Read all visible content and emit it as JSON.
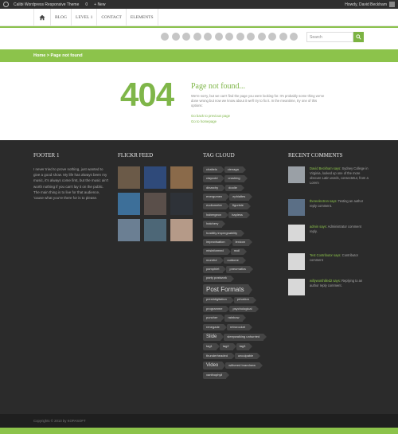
{
  "adminbar": {
    "site_name": "Calibi Wordpress Responsive Theme",
    "comments_count": "0",
    "new_label": "+ New",
    "howdy": "Howdy, David Beckham"
  },
  "nav": {
    "items": [
      "BLOG",
      "LEVEL 1",
      "CONTACT",
      "ELEMENTS"
    ]
  },
  "social_icons": [
    "rss-icon",
    "facebook-icon",
    "twitter-icon",
    "pinterest-icon",
    "google-plus-icon",
    "dribbble-icon",
    "flickr-icon",
    "vimeo-icon",
    "linkedin-icon",
    "skype-icon",
    "youtube-icon",
    "tumblr-icon",
    "foursquare-icon"
  ],
  "search": {
    "placeholder": "Search"
  },
  "breadcrumb": "Home > Page not found",
  "error": {
    "code": "404",
    "title": "Page not found...",
    "message": "We're sorry, but we can't find the page you were looking for. It's probably some thing we've done wrong but now we know about it we'll try to fix it. In the meantime, try one of this options:",
    "link_back": "Go back to previous page",
    "link_home": "Go to homepage"
  },
  "footer": {
    "footer1_title": "FOOTER 1",
    "footer1_text": "I never tried to prove nothing, just wanted to give a good show. My life has always been my music, it's always come first, but the music ain't worth nothing if you can't lay it on the public. The main thing is to live for that audience, 'cause what you're there for is to please.",
    "flickr_title": "FLICKR FEED",
    "tag_title": "TAG CLOUD",
    "comments_title": "RECENT COMMENTS",
    "copyright": "Copyrights © 2013 by KOPASOFT"
  },
  "flickr_photos": [
    {
      "color": "#6b5a48"
    },
    {
      "color": "#2f4a7a"
    },
    {
      "color": "#8a6a4a"
    },
    {
      "color": "#3d6f99"
    },
    {
      "color": "#5a4f4a"
    },
    {
      "color": "#2e3238"
    },
    {
      "color": "#6b7f93"
    },
    {
      "color": "#4d6777"
    },
    {
      "color": "#b59a88"
    }
  ],
  "tags": [
    [
      "chattels",
      "cienaga"
    ],
    [
      "claycold",
      "crushing"
    ],
    [
      "dinarchy",
      "doolie"
    ],
    [
      "energumen",
      "ephialtes"
    ],
    [
      "eudiometer",
      "figuriste"
    ],
    [
      "habergeon",
      "hapless"
    ],
    [
      "hatchery"
    ],
    [
      "hostility impregnability"
    ],
    [
      "improvisation",
      "lexicon"
    ],
    [
      "misinformed",
      "moil"
    ],
    [
      "mornful",
      "outdone"
    ],
    [
      "pamphlet",
      "pneumatics"
    ],
    [
      "party postwork"
    ],
    [
      "Post Formats"
    ],
    [
      "prestidigitation",
      "privation"
    ],
    [
      "programme",
      "psychological"
    ],
    [
      "puncher",
      "rainbow"
    ],
    [
      "renegade",
      "retrorocket"
    ],
    [
      "Slide",
      "sleepwalking unhurried"
    ],
    [
      "tag1",
      "tag2",
      "tag3"
    ],
    [
      "thunderheaded",
      "unculpable"
    ],
    [
      "Video",
      "withered brandnew"
    ],
    [
      "xanthophyll"
    ]
  ],
  "comments": [
    {
      "author": "David Beckham",
      "says": "says:",
      "text": "Sydney College in Virginia, looked up one of the more obscure Latin words, consectetur, from a Lorem",
      "avatar": "#9aa0a6"
    },
    {
      "author": "thereelectron",
      "says": "says:",
      "text": "Testing an author reply comment.",
      "avatar": "#5b6f86"
    },
    {
      "author": "admin",
      "says": "says:",
      "text": "Administrator comment reply.",
      "avatar": "#d8d8d8"
    },
    {
      "author": "Test Contributor",
      "says": "says:",
      "text": "Contributor comment",
      "avatar": "#d8d8d8"
    },
    {
      "author": "willywonthilled2",
      "says": "says:",
      "text": "Replying to an author reply comment.",
      "avatar": "#d8d8d8"
    }
  ],
  "colors": {
    "accent": "#8cc34b",
    "footer_bg": "#2b2b2b"
  }
}
